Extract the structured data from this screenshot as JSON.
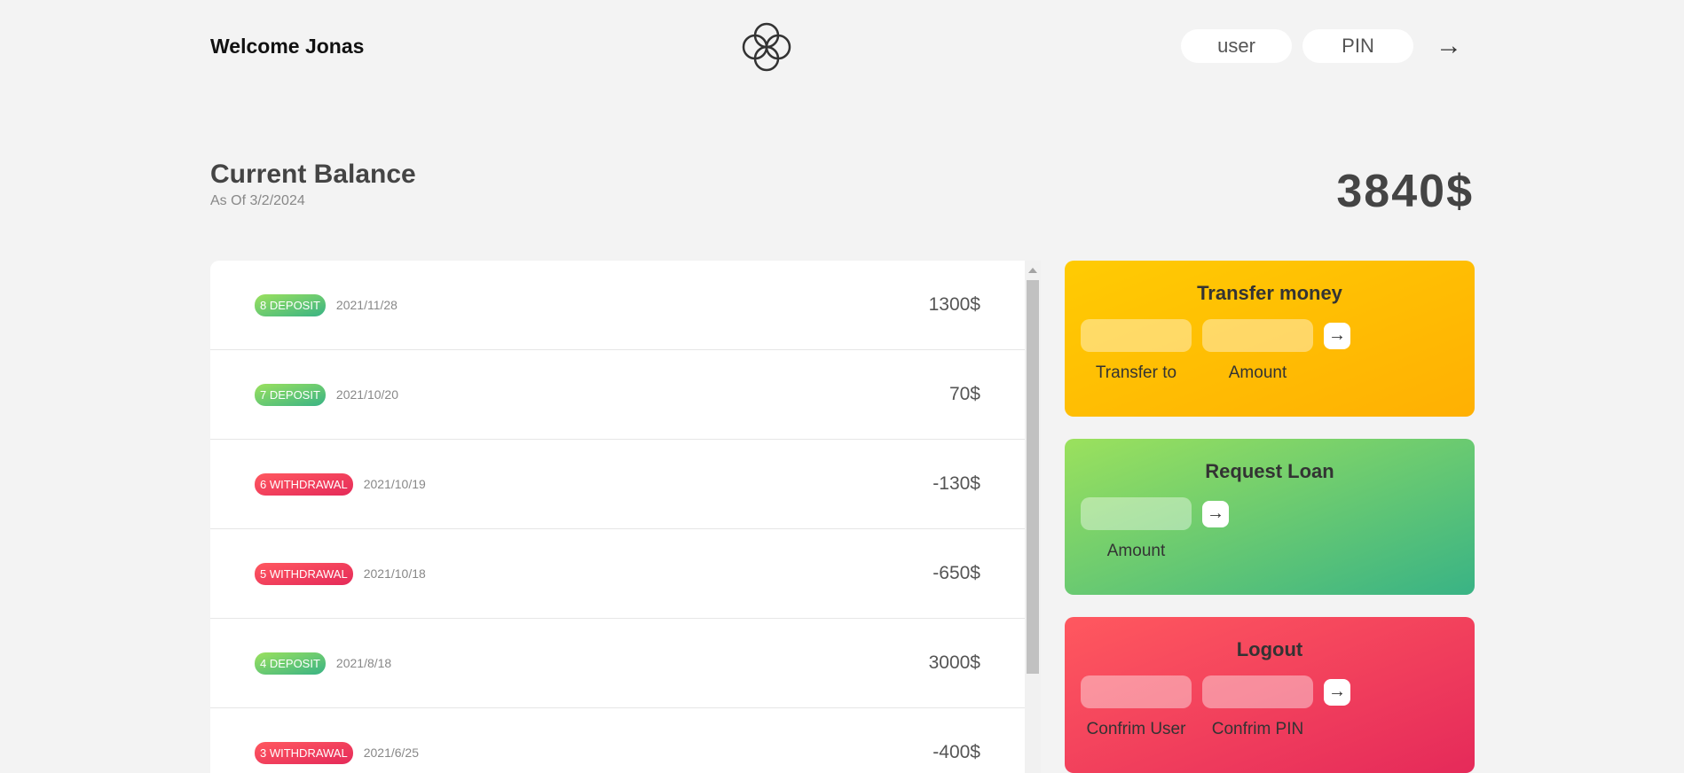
{
  "nav": {
    "welcome": "Welcome Jonas",
    "logo_icon": "four-circles-logo-icon",
    "user_placeholder": "user",
    "pin_placeholder": "PIN",
    "login_button": "→"
  },
  "balance": {
    "label": "Current Balance",
    "date": "As Of 3/2/2024",
    "value": "3840$"
  },
  "movements": [
    {
      "type": "8 DEPOSIT",
      "kind": "deposit",
      "date": "2021/11/28",
      "value": "1300$"
    },
    {
      "type": "7 DEPOSIT",
      "kind": "deposit",
      "date": "2021/10/20",
      "value": "70$"
    },
    {
      "type": "6 WITHDRAWAL",
      "kind": "withdrawal",
      "date": "2021/10/19",
      "value": "-130$"
    },
    {
      "type": "5 WITHDRAWAL",
      "kind": "withdrawal",
      "date": "2021/10/18",
      "value": "-650$"
    },
    {
      "type": "4 DEPOSIT",
      "kind": "deposit",
      "date": "2021/8/18",
      "value": "3000$"
    },
    {
      "type": "3 WITHDRAWAL",
      "kind": "withdrawal",
      "date": "2021/6/25",
      "value": "-400$"
    }
  ],
  "operations": {
    "transfer": {
      "title": "Transfer money",
      "label_to": "Transfer to",
      "label_amount": "Amount",
      "button": "→"
    },
    "loan": {
      "title": "Request Loan",
      "label_amount": "Amount",
      "button": "→"
    },
    "close": {
      "title": "Logout",
      "label_user": "Confrim User",
      "label_pin": "Confrim PIN",
      "button": "→"
    }
  },
  "colors": {
    "deposit": "#39b385",
    "withdrawal": "#e52a5a",
    "transfer": "#ffb003"
  }
}
